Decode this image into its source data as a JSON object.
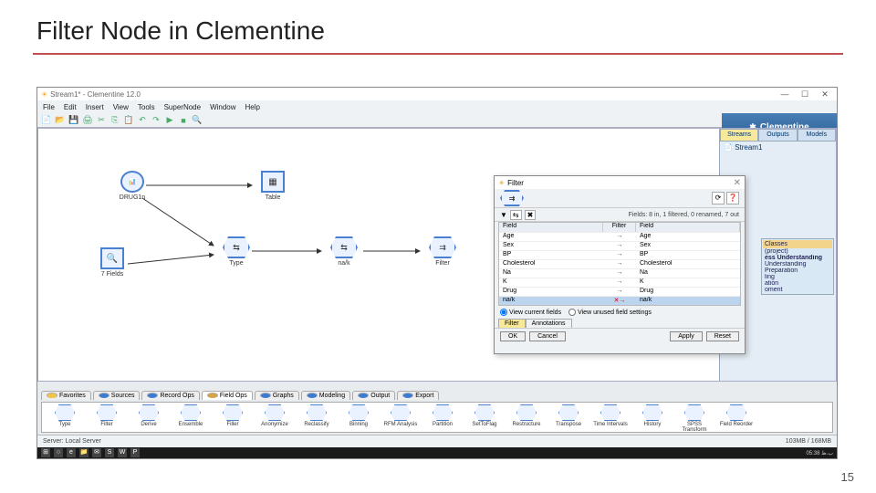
{
  "slide": {
    "title": "Filter Node in Clementine",
    "page": "15"
  },
  "titlebar": {
    "text": "Stream1* - Clementine 12.0"
  },
  "menubar": [
    "File",
    "Edit",
    "Insert",
    "View",
    "Tools",
    "SuperNode",
    "Window",
    "Help"
  ],
  "brand": "Clementine",
  "side": {
    "tabs": [
      "Streams",
      "Outputs",
      "Models"
    ],
    "item": "Stream1"
  },
  "crisp": {
    "header": "Classes",
    "items": [
      "(project)",
      "ess Understanding",
      "Understanding",
      "Preparation",
      "ling",
      "ation",
      "oment"
    ]
  },
  "canvas_nodes": {
    "drug": "DRUG1n",
    "table": "Table",
    "fields": "7 Fields",
    "type": "Type",
    "nak": "na/k",
    "filter": "Filter"
  },
  "filter_dialog": {
    "title": "Filter",
    "summary": "Fields: 8 in, 1 filtered, 0 renamed, 7 out",
    "columns": [
      "Field",
      "Filter",
      "Field"
    ],
    "rows": [
      {
        "in": "Age",
        "pass": true,
        "out": "Age"
      },
      {
        "in": "Sex",
        "pass": true,
        "out": "Sex"
      },
      {
        "in": "BP",
        "pass": true,
        "out": "BP"
      },
      {
        "in": "Cholesterol",
        "pass": true,
        "out": "Cholesterol"
      },
      {
        "in": "Na",
        "pass": true,
        "out": "Na"
      },
      {
        "in": "K",
        "pass": true,
        "out": "K"
      },
      {
        "in": "Drug",
        "pass": true,
        "out": "Drug"
      },
      {
        "in": "na/k",
        "pass": false,
        "out": "na/k"
      }
    ],
    "radio1": "View current fields",
    "radio2": "View unused field settings",
    "tabs": [
      "Filter",
      "Annotations"
    ],
    "buttons": {
      "ok": "OK",
      "cancel": "Cancel",
      "apply": "Apply",
      "reset": "Reset"
    }
  },
  "palette_tabs": [
    {
      "label": "Favorites",
      "color": "#f4c542"
    },
    {
      "label": "Sources",
      "color": "#3a7bd5"
    },
    {
      "label": "Record Ops",
      "color": "#3a7bd5"
    },
    {
      "label": "Field Ops",
      "color": "#d9a440",
      "active": true
    },
    {
      "label": "Graphs",
      "color": "#3a7bd5"
    },
    {
      "label": "Modeling",
      "color": "#3a7bd5"
    },
    {
      "label": "Output",
      "color": "#3a7bd5"
    },
    {
      "label": "Export",
      "color": "#3a7bd5"
    }
  ],
  "palette_nodes": [
    "Type",
    "Filter",
    "Derive",
    "Ensemble",
    "Filler",
    "Anonymize",
    "Reclassify",
    "Binning",
    "RFM Analysis",
    "Partition",
    "SetToFlag",
    "Restructure",
    "Transpose",
    "Time Intervals",
    "History",
    "SPSS Transform",
    "Field Reorder"
  ],
  "status": {
    "server": "Server: Local Server",
    "mem": "103MB / 168MB"
  },
  "taskbar": {
    "clock": "05:38 ب.ظ"
  }
}
